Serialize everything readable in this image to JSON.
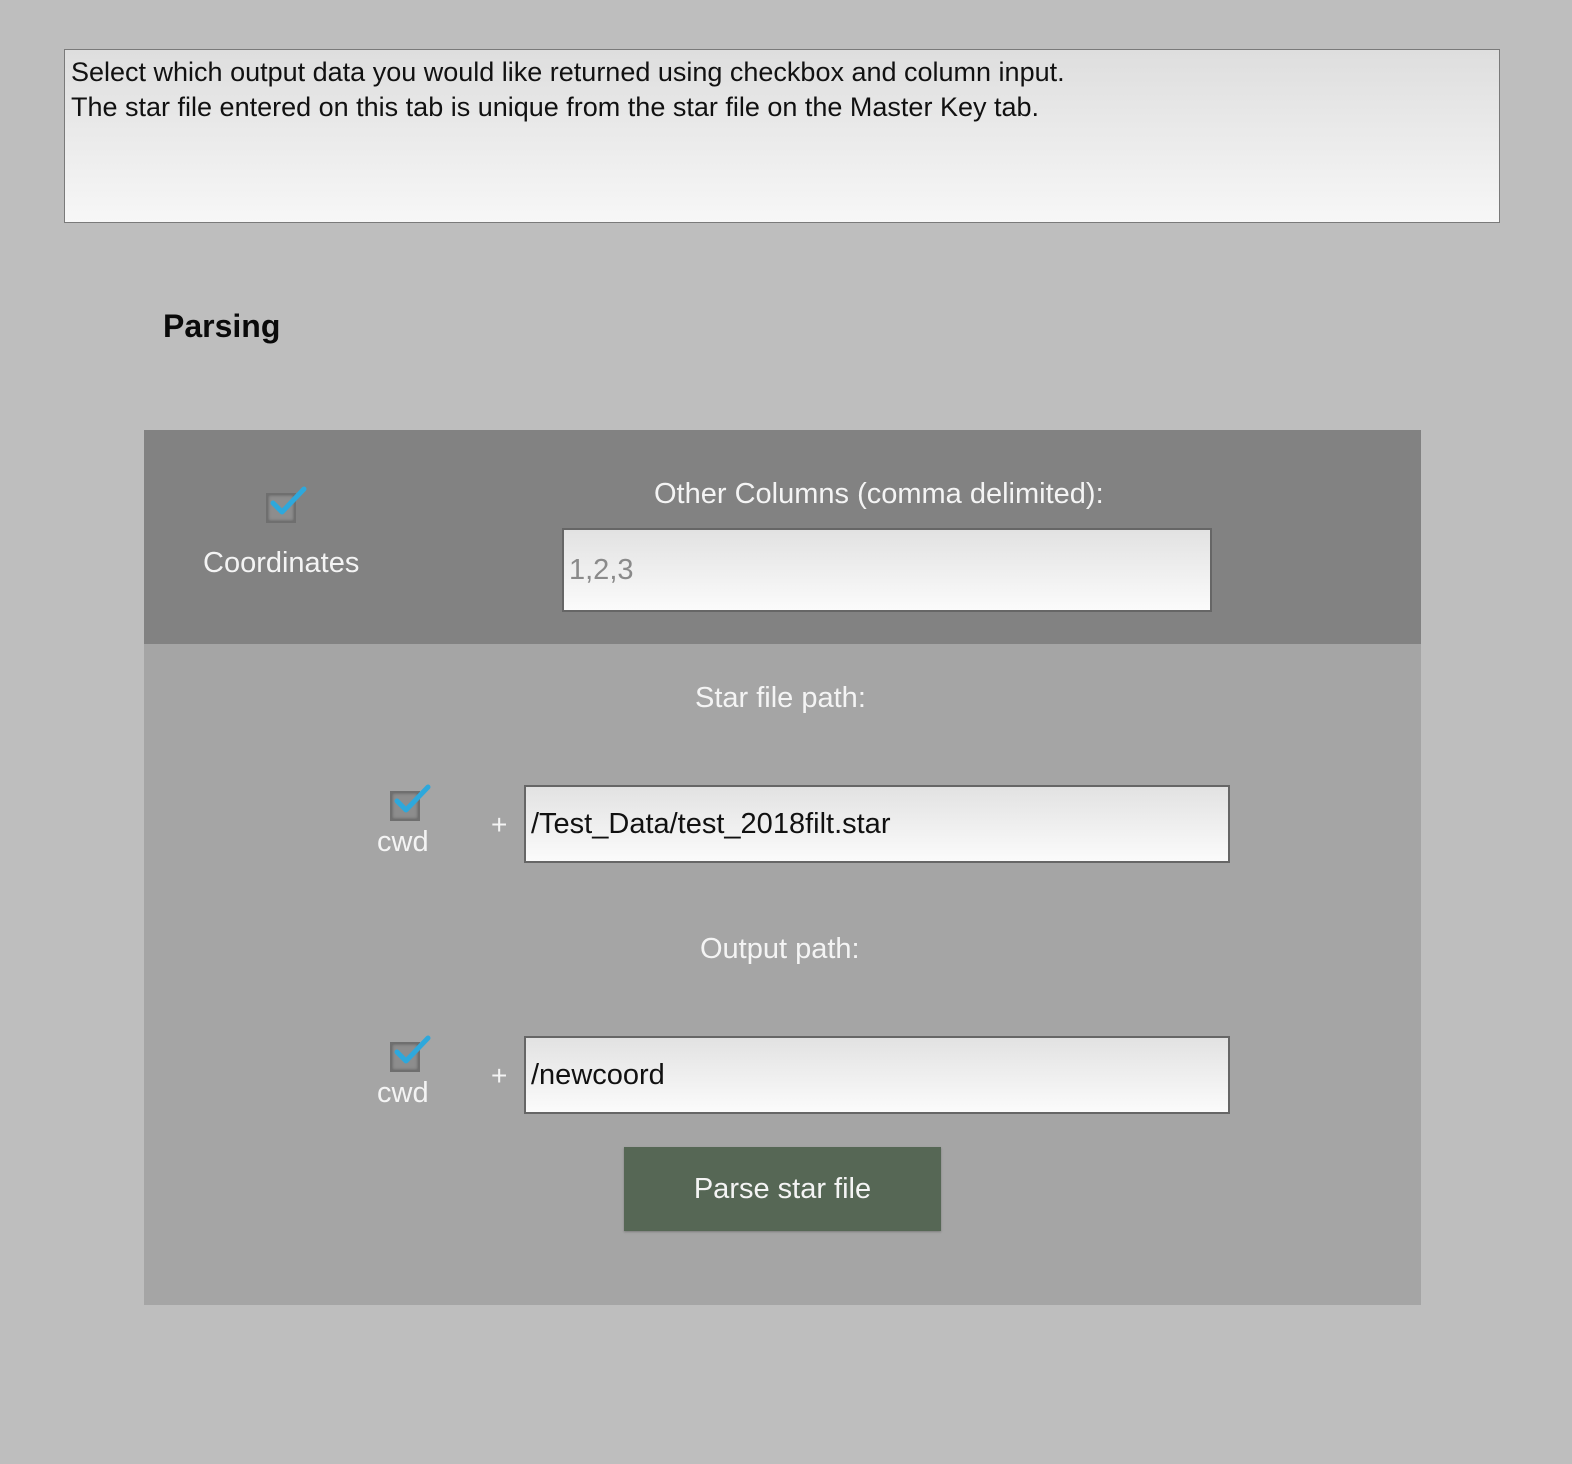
{
  "instructions": {
    "line1": "Select which output data you would like returned using checkbox and column input.",
    "line2": "The star file entered on this tab is unique from the star file on the Master Key tab."
  },
  "section": {
    "title": "Parsing"
  },
  "columns": {
    "coordinates_checked": true,
    "coordinates_label": "Coordinates",
    "other_columns_label": "Other Columns (comma delimited):",
    "other_columns_value": "",
    "other_columns_placeholder": "1,2,3"
  },
  "star_file": {
    "label": "Star file path:",
    "cwd_checked": true,
    "cwd_label": "cwd",
    "plus": "+",
    "path_value": "/Test_Data/test_2018filt.star"
  },
  "output": {
    "label": "Output path:",
    "cwd_checked": true,
    "cwd_label": "cwd",
    "plus": "+",
    "path_value": "/newcoord"
  },
  "actions": {
    "parse_label": "Parse star file"
  },
  "colors": {
    "page_background": "#bebebe",
    "panel_background": "#a5a5a5",
    "panel_header_background": "#828282",
    "button_background": "#566755",
    "checkmark": "#2ea8dc"
  },
  "icons": {
    "checkbox": "checkmark-icon"
  }
}
